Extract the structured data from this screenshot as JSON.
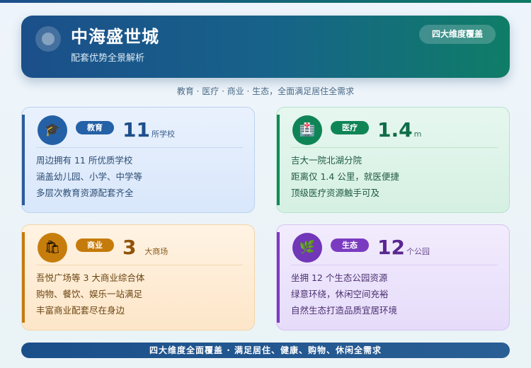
{
  "header": {
    "title": "中海盛世城",
    "subtitle": "配套优势全景解析",
    "badge": "四大维度覆盖"
  },
  "tagline": "教育 · 医疗 · 商业 · 生态，全面满足居住全需求",
  "cards": [
    {
      "icon": "graduation-cap-icon",
      "icon_glyph": "🎓",
      "tag": "教育",
      "number": "11",
      "unit": "所学校",
      "lines": [
        "周边拥有 11 所优质学校",
        "涵盖幼儿园、小学、中学等",
        "多层次教育资源配套齐全"
      ]
    },
    {
      "icon": "hospital-icon",
      "icon_glyph": "🏥",
      "tag": "医疗",
      "number": "1.4",
      "unit": "m",
      "lines": [
        "吉大一院北湖分院",
        "距离仅 1.4 公里，就医便捷",
        "顶级医疗资源触手可及"
      ]
    },
    {
      "icon": "shopping-bags-icon",
      "icon_glyph": "🛍",
      "tag": "商业",
      "number": "3",
      "unit": "大商场",
      "lines": [
        "吾悦广场等 3 大商业综合体",
        "购物、餐饮、娱乐一站满足",
        "丰富商业配套尽在身边"
      ]
    },
    {
      "icon": "leaf-icon",
      "icon_glyph": "🌿",
      "tag": "生态",
      "number": "12",
      "unit": "个公园",
      "lines": [
        "坐拥 12 个生态公园资源",
        "绿意环绕，休闲空间充裕",
        "自然生态打造品质宜居环境"
      ]
    }
  ],
  "footer": "四大维度全面覆盖 · 满足居住、健康、购物、休闲全需求",
  "colors": {
    "education": "#2461a6",
    "medical": "#0f8556",
    "commerce": "#c57b0b",
    "ecology": "#7a3bc1"
  }
}
